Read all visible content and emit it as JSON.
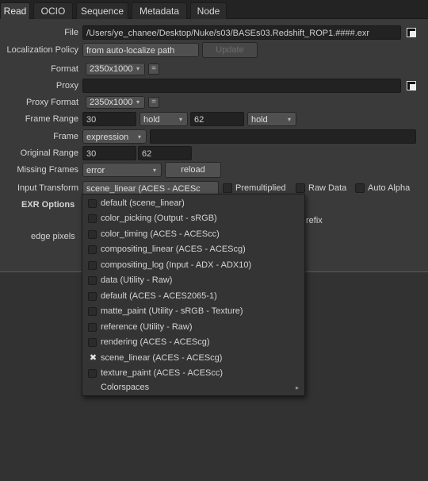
{
  "tabs": [
    "Read",
    "OCIO",
    "Sequence",
    "Metadata",
    "Node"
  ],
  "labels": {
    "file": "File",
    "localization_policy": "Localization Policy",
    "format": "Format",
    "proxy": "Proxy",
    "proxy_format": "Proxy Format",
    "frame_range": "Frame Range",
    "frame": "Frame",
    "original_range": "Original Range",
    "missing_frames": "Missing Frames",
    "input_transform": "Input Transform",
    "exr_options": "EXR Options",
    "edge_pixels": "edge pixels",
    "prefix_partial": "refix"
  },
  "fields": {
    "file_path": "/Users/ye_chanee/Desktop/Nuke/s03/BASEs03.Redshift_ROP1.####.exr",
    "localization_value": "from auto-localize path",
    "update_button": "Update",
    "format_value": "2350x1000",
    "proxy_path": "",
    "proxy_format_value": "2350x1000",
    "eq_symbol": "=",
    "frame_start": "30",
    "frame_start_mode": "hold",
    "frame_end": "62",
    "frame_end_mode": "hold",
    "frame_mode": "expression",
    "frame_expression": "",
    "original_start": "30",
    "original_end": "62",
    "missing_frames_value": "error",
    "reload_button": "reload",
    "input_transform_value": "scene_linear (ACES - ACESc",
    "premultiplied": "Premultiplied",
    "raw_data": "Raw Data",
    "auto_alpha": "Auto Alpha"
  },
  "menu": {
    "items": [
      {
        "label": "default (scene_linear)",
        "checked": false
      },
      {
        "label": "color_picking (Output - sRGB)",
        "checked": false
      },
      {
        "label": "color_timing (ACES - ACEScc)",
        "checked": false
      },
      {
        "label": "compositing_linear (ACES - ACEScg)",
        "checked": false
      },
      {
        "label": "compositing_log (Input - ADX - ADX10)",
        "checked": false
      },
      {
        "label": "data (Utility - Raw)",
        "checked": false
      },
      {
        "label": "default (ACES - ACES2065-1)",
        "checked": false
      },
      {
        "label": "matte_paint (Utility - sRGB - Texture)",
        "checked": false
      },
      {
        "label": "reference (Utility - Raw)",
        "checked": false
      },
      {
        "label": "rendering (ACES - ACEScg)",
        "checked": false
      },
      {
        "label": "scene_linear (ACES - ACEScg)",
        "checked": true
      },
      {
        "label": "texture_paint (ACES - ACEScc)",
        "checked": false
      }
    ],
    "submenu_label": "Colorspaces",
    "check_glyph": "✖",
    "submenu_glyph": "▸"
  },
  "icons": {
    "dropdown_arrow": "▾",
    "folder": "folder-icon"
  },
  "colors": {
    "panel": "#3a3a3a",
    "field": "#222222",
    "button": "#505050",
    "text": "#d0d0d0"
  }
}
